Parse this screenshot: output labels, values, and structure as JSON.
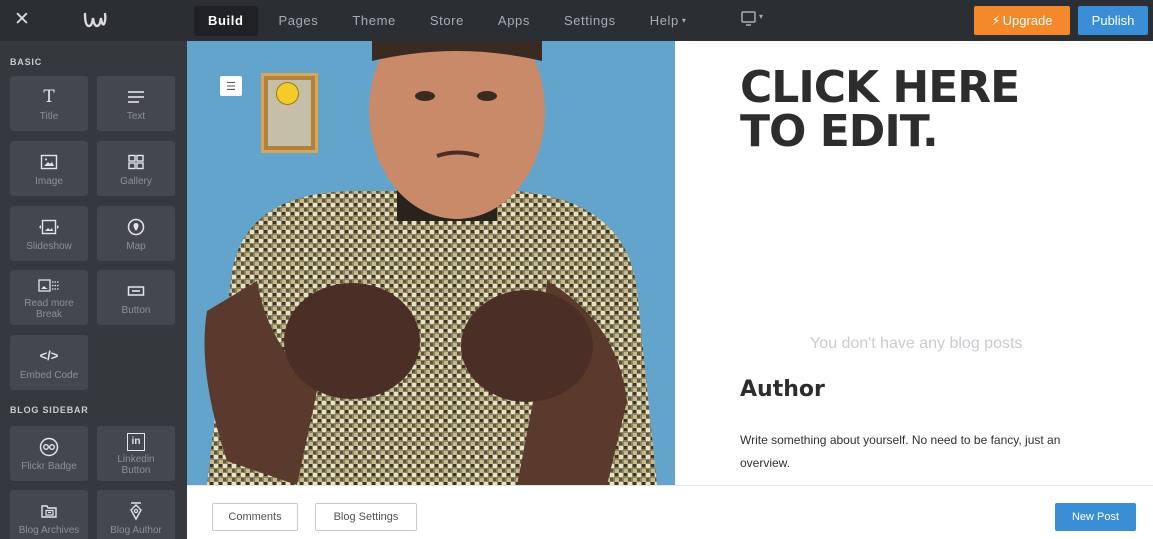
{
  "topbar": {
    "close_icon": "close-icon",
    "logo_icon": "weebly-logo-icon",
    "nav": [
      {
        "label": "Build",
        "active": true
      },
      {
        "label": "Pages"
      },
      {
        "label": "Theme"
      },
      {
        "label": "Store"
      },
      {
        "label": "Apps"
      },
      {
        "label": "Settings"
      },
      {
        "label": "Help",
        "caret": "▾"
      }
    ],
    "device_caret": "▾",
    "upgrade": {
      "icon": "lightning-icon",
      "glyph": "⚡",
      "label": "Upgrade",
      "color": "#f3892b"
    },
    "publish": {
      "label": "Publish",
      "color": "#3a8ed6"
    }
  },
  "sidebar": {
    "basic_label": "BASIC",
    "blog_sidebar_label": "BLOG SIDEBAR",
    "basic_items": [
      {
        "label": "Title",
        "icon": "title-icon",
        "glyph": "T"
      },
      {
        "label": "Text",
        "icon": "text-icon",
        "glyph": "☰"
      },
      {
        "label": "Image",
        "icon": "image-icon",
        "glyph": ""
      },
      {
        "label": "Gallery",
        "icon": "gallery-icon",
        "glyph": ""
      },
      {
        "label": "Slideshow",
        "icon": "slideshow-icon",
        "glyph": ""
      },
      {
        "label": "Map",
        "icon": "map-pin-icon",
        "glyph": ""
      },
      {
        "label": "Read more\nBreak",
        "icon": "read-more-icon",
        "glyph": ""
      },
      {
        "label": "Button",
        "icon": "button-icon",
        "glyph": ""
      },
      {
        "label": "Embed Code",
        "icon": "embed-code-icon",
        "glyph": "</>"
      }
    ],
    "blog_items": [
      {
        "label": "Flickr Badge",
        "icon": "flickr-icon",
        "glyph": ""
      },
      {
        "label": "Linkedin\nButton",
        "icon": "linkedin-icon",
        "glyph": "in"
      },
      {
        "label": "Blog Archives",
        "icon": "archive-icon",
        "glyph": ""
      },
      {
        "label": "Blog Author",
        "icon": "author-pen-icon",
        "glyph": ""
      }
    ]
  },
  "canvas": {
    "headline": "CLICK HERE\nTO EDIT.",
    "no_posts": "You don't have any blog posts",
    "author_title": "Author",
    "author_desc": "Write something about yourself. No need to be fancy, just an overview."
  },
  "bottombar": {
    "comments": "Comments",
    "blog_settings": "Blog Settings",
    "new_post": "New Post"
  }
}
